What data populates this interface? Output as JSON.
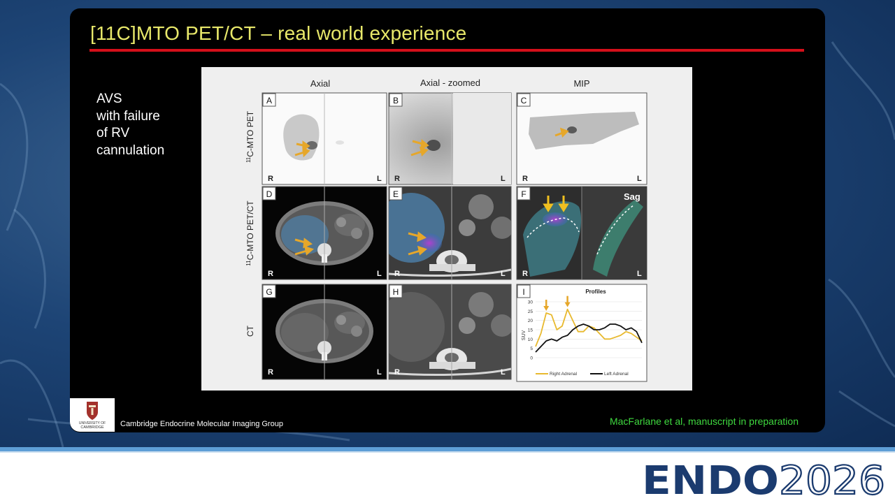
{
  "slide": {
    "title": "[11C]MTO PET/CT – real world experience",
    "side_text": [
      "AVS",
      "with failure",
      "of RV",
      "cannulation"
    ],
    "group_name": "Cambridge Endocrine Molecular Imaging Group",
    "citation": "MacFarlane et al, manuscript in preparation"
  },
  "logos": {
    "university_text": [
      "UNIVERSITY OF",
      "CAMBRIDGE"
    ],
    "conference_word": "ENDO",
    "conference_year": "2026"
  },
  "figure": {
    "columns": [
      "Axial",
      "Axial - zoomed",
      "MIP"
    ],
    "row_labels": [
      "C-MTO PET",
      "C-MTO PET/CT",
      "CT"
    ],
    "isotope_superscript": "11",
    "panels": [
      "A",
      "B",
      "C",
      "D",
      "E",
      "F",
      "G",
      "H",
      "I"
    ],
    "side_left": "R",
    "side_right": "L",
    "sag_label": "Sag"
  },
  "chart_data": {
    "type": "line",
    "title": "Profiles",
    "ylabel": "SUV",
    "xlabel": "",
    "ylim": [
      0,
      30
    ],
    "yticks": [
      0,
      5,
      10,
      15,
      20,
      25,
      30
    ],
    "x": [
      0,
      1,
      2,
      3,
      4,
      5,
      6,
      7,
      8,
      9,
      10,
      11,
      12,
      13,
      14,
      15,
      16,
      17,
      18,
      19,
      20
    ],
    "series": [
      {
        "name": "Right Adrenal",
        "color": "#e8b92e",
        "values": [
          6,
          13,
          24,
          23,
          15,
          17,
          26,
          20,
          14,
          14,
          17,
          16,
          13,
          10,
          10,
          11,
          12,
          14,
          13,
          11,
          9
        ]
      },
      {
        "name": "Left Adrenal",
        "color": "#111111",
        "values": [
          3,
          6,
          9,
          10,
          9,
          11,
          12,
          15,
          17,
          18,
          17,
          15,
          15,
          16,
          18,
          18,
          17,
          15,
          16,
          14,
          8
        ]
      }
    ],
    "legend": "bottom"
  }
}
